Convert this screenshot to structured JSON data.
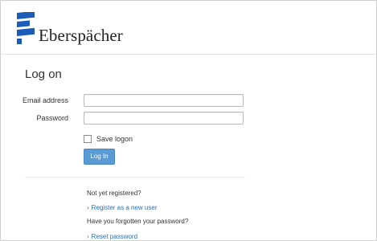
{
  "header": {
    "brand_name": "Eberspächer"
  },
  "main": {
    "title": "Log on",
    "email_label": "Email address",
    "email_value": "",
    "password_label": "Password",
    "password_value": "",
    "save_logon_label": "Save logon",
    "save_logon_checked": false,
    "login_button_label": "Log In",
    "not_registered_text": "Not yet registered?",
    "register_link_label": "Register as a new user",
    "forgot_password_text": "Have you forgotten your password?",
    "reset_link_label": "Reset password",
    "link_arrow": "›"
  },
  "colors": {
    "accent_button": "#5b9bd5",
    "link": "#2c6fb3",
    "logo": "#1b5cb8"
  },
  "icons": {
    "logo": "eberspaecher-logo-icon",
    "link_arrow": "chevron-right-icon"
  }
}
